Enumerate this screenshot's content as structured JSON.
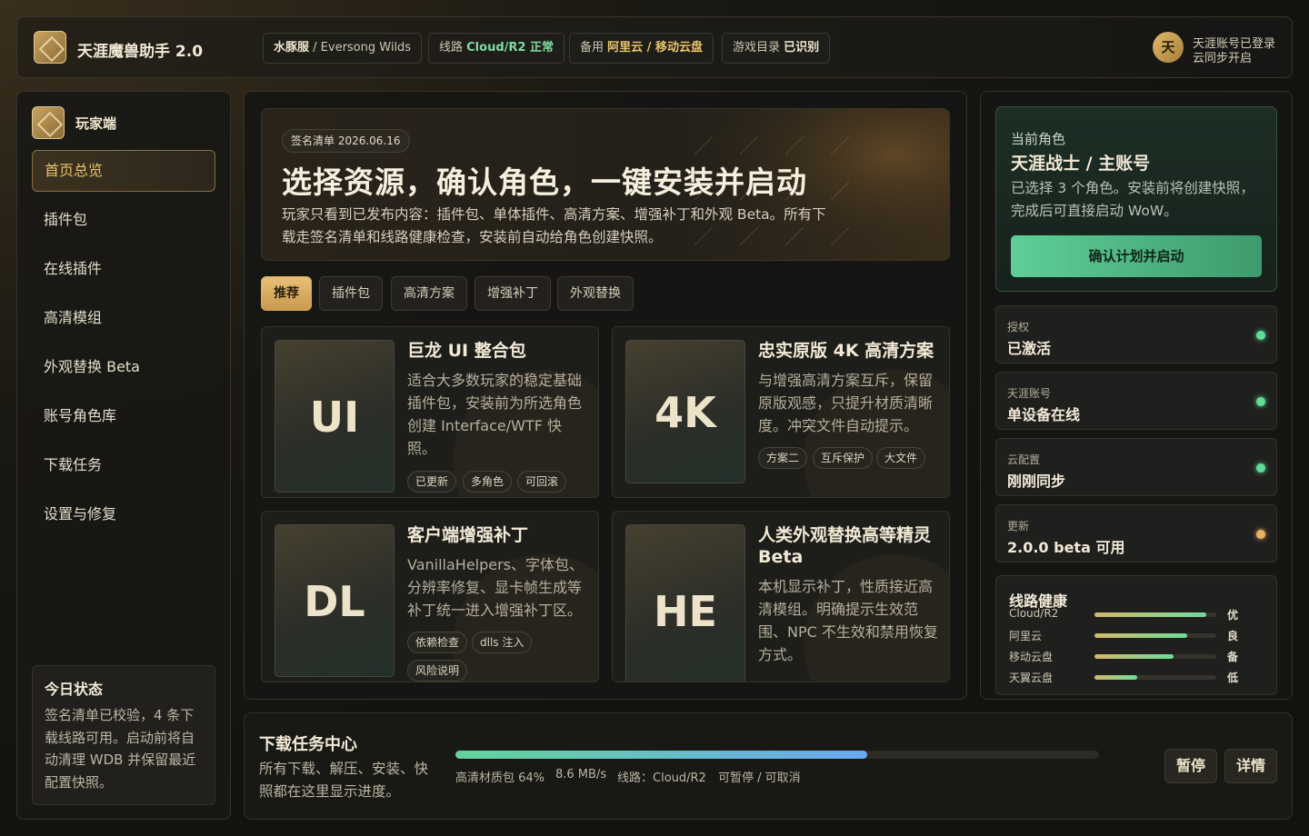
{
  "app": {
    "title": "天涯魔兽助手 2.0",
    "logo_icon": "diamond-logo-icon"
  },
  "topbar": {
    "chips": [
      {
        "prefix": "水豚服",
        "suffix": " / Eversong Wilds"
      },
      {
        "prefix": "线路 ",
        "value": "Cloud/R2 正常"
      },
      {
        "prefix": "备用 ",
        "value": "阿里云 / 移动云盘"
      },
      {
        "prefix": "游戏目录 ",
        "value": "已识别"
      }
    ],
    "account": {
      "avatar": "天",
      "line1": "天涯账号已登录",
      "line2": "云同步开启"
    }
  },
  "sidebar": {
    "brand": "玩家端",
    "items": [
      {
        "label": "首页总览",
        "active": true
      },
      {
        "label": "插件包"
      },
      {
        "label": "在线插件"
      },
      {
        "label": "高清模组"
      },
      {
        "label": "外观替换 Beta"
      },
      {
        "label": "账号角色库"
      },
      {
        "label": "下载任务"
      },
      {
        "label": "设置与修复"
      }
    ],
    "today": {
      "title": "今日状态",
      "text": "签名清单已校验，4 条下载线路可用。启动前将自动清理 WDB 并保留最近配置快照。"
    }
  },
  "hero": {
    "tag": "签名清单 2026.06.16",
    "title": "选择资源，确认角色，一键安装并启动",
    "desc": "玩家只看到已发布内容：插件包、单体插件、高清方案、增强补丁和外观 Beta。所有下载走签名清单和线路健康检查，安装前自动给角色创建快照。"
  },
  "tabs": [
    {
      "label": "推荐",
      "active": true
    },
    {
      "label": "插件包"
    },
    {
      "label": "高清方案"
    },
    {
      "label": "增强补丁"
    },
    {
      "label": "外观替换"
    }
  ],
  "cards": [
    {
      "thumb": "UI",
      "title": "巨龙 UI 整合包",
      "desc": "适合大多数玩家的稳定基础插件包，安装前为所选角色创建 Interface/WTF 快照。",
      "tags": [
        "已更新",
        "多角色",
        "可回滚"
      ]
    },
    {
      "thumb": "4K",
      "title": "忠实原版 4K 高清方案",
      "desc": "与增强高清方案互斥，保留原版观感，只提升材质清晰度。冲突文件自动提示。",
      "tags": [
        "方案二",
        "互斥保护",
        "大文件"
      ]
    },
    {
      "thumb": "DL",
      "title": "客户端增强补丁",
      "desc": "VanillaHelpers、字体包、分辨率修复、显卡帧生成等补丁统一进入增强补丁区。",
      "tags": [
        "依赖检查",
        "dlls 注入",
        "风险说明"
      ]
    },
    {
      "thumb": "HE",
      "title": "人类外观替换高等精灵 Beta",
      "desc": "本机显示补丁，性质接近高清模组。明确提示生效范围、NPC 不生效和禁用恢复方式。",
      "tags": []
    }
  ],
  "role": {
    "label": "当前角色",
    "name": "天涯战士 / 主账号",
    "desc": "已选择 3 个角色。安装前将创建快照，完成后可直接启动 WoW。",
    "button": "确认计划并启动"
  },
  "statuses": [
    {
      "key": "授权",
      "value": "已激活",
      "color": "#5fdc96"
    },
    {
      "key": "天涯账号",
      "value": "单设备在线",
      "color": "#5fdc96"
    },
    {
      "key": "云配置",
      "value": "刚刚同步",
      "color": "#5fdc96"
    },
    {
      "key": "更新",
      "value": "2.0.0 beta 可用",
      "color": "#e8b062"
    }
  ],
  "routes": {
    "title": "线路健康",
    "items": [
      {
        "name": "Cloud/R2",
        "level": 0.92,
        "grade": "优"
      },
      {
        "name": "阿里云",
        "level": 0.76,
        "grade": "良"
      },
      {
        "name": "移动云盘",
        "level": 0.65,
        "grade": "备"
      },
      {
        "name": "天翼云盘",
        "level": 0.35,
        "grade": "低"
      }
    ]
  },
  "download": {
    "title": "下载任务中心",
    "desc": "所有下载、解压、安装、快照都在这里显示进度。",
    "progress": 0.64,
    "task": "高清材质包 64%",
    "speed": "8.6 MB/s",
    "route": "线路：Cloud/R2",
    "control": "可暂停 / 可取消",
    "pause": "暂停",
    "detail": "详情"
  }
}
